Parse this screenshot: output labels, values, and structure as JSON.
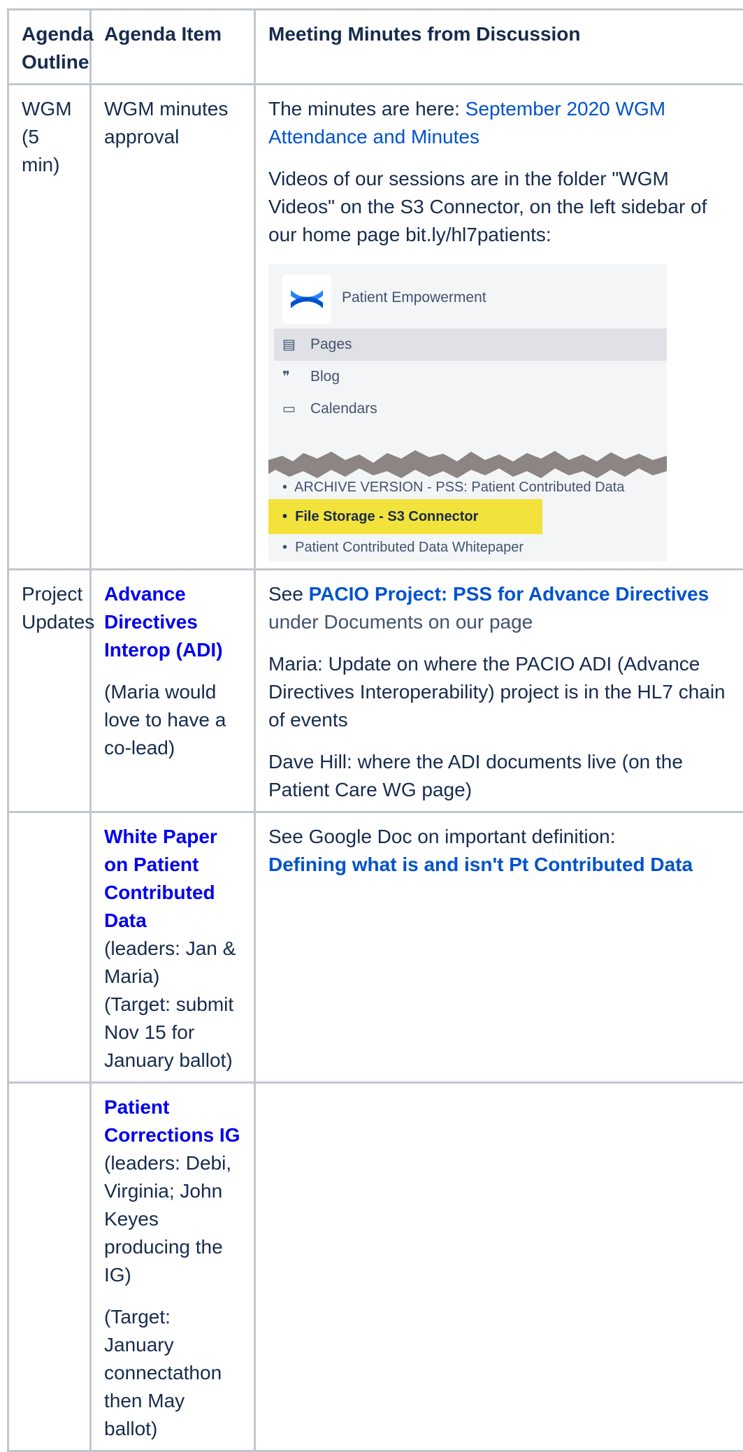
{
  "table": {
    "headers": [
      "Agenda Outline",
      "Agenda Item",
      "Meeting Minutes from Discussion"
    ],
    "row1": {
      "outline": "WGM (5 min)",
      "item": "WGM minutes approval",
      "minutes_prefix": "The minutes are here: ",
      "minutes_link": "September 2020 WGM Attendance and Minutes",
      "videos_text": "Videos of our sessions are in the folder \"WGM Videos\" on the S3 Connector, on the left sidebar of our home page bit.ly/hl7patients:",
      "screenshot": {
        "space_name": "Patient Empowerment",
        "nav": [
          {
            "icon": "pages-icon",
            "glyph": "▤",
            "label": "Pages"
          },
          {
            "icon": "blog-icon",
            "glyph": "❞",
            "label": "Blog"
          },
          {
            "icon": "calendar-icon",
            "glyph": "▭",
            "label": "Calendars"
          }
        ],
        "list": [
          "ARCHIVE VERSION - PSS: Patient Contributed Data",
          "File Storage - S3 Connector",
          "Patient Contributed Data Whitepaper"
        ],
        "highlight_color": "#f3e23b"
      }
    },
    "row2": {
      "outline": "Project Updates",
      "item_link": "Advance Directives Interop (ADI)",
      "item_note": "(Maria would love to have a co-lead)",
      "see_prefix": "See ",
      "see_link": "PACIO Project: PSS for Advance Directives",
      "see_suffix": " under Documents on our page",
      "maria": "Maria: Update on where the PACIO ADI (Advance Directives Interoperability) project is in the HL7 chain of events",
      "dave": "Dave Hill: where the ADI documents live (on the Patient Care WG page)"
    },
    "row3": {
      "item_link": "White Paper on Patient Contributed Data",
      "leaders": "(leaders: Jan & Maria)",
      "target": "(Target: submit Nov 15 for January ballot)",
      "doc_text": "See Google Doc on important definition:",
      "doc_link": "Defining what is and isn't Pt Contributed Data"
    },
    "row4": {
      "item_link": "Patient Corrections IG",
      "leaders": "(leaders: Debi, Virginia; John Keyes producing the IG)",
      "target": "(Target: January connectathon then May ballot)"
    }
  },
  "colors": {
    "link": "#0052cc",
    "link_bold": "#0000ee",
    "border": "#c1c7d0",
    "text": "#172b4d"
  }
}
